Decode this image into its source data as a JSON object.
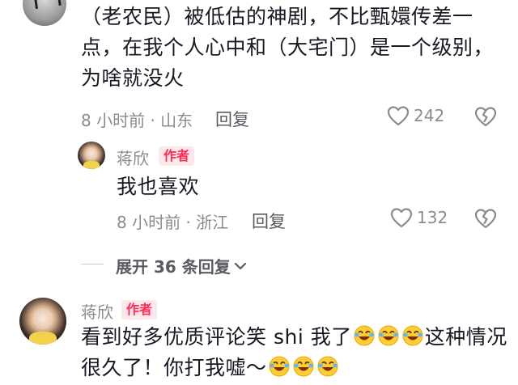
{
  "comments": [
    {
      "text": "（老农民）被低估的神剧，不比甄嬛传差一点，在我个人心中和（大宅门）是一个级别，为啥就没火",
      "line1": "（老农民）被低估的神剧，不比甄嬛传差一",
      "line2": "点，在我个人心中和（大宅门）是一个级别，",
      "line3": "为啥就没火",
      "meta": "8 小时前 · 山东",
      "reply_label": "回复",
      "likes": "242",
      "replies": [
        {
          "username": "蒋欣",
          "badge": "作者",
          "text": "我也喜欢",
          "meta": "8 小时前 · 浙江",
          "reply_label": "回复",
          "likes": "132"
        }
      ],
      "expand_label": "展开 36 条回复"
    },
    {
      "username": "蒋欣",
      "badge": "作者",
      "text_line1": "看到好多优质评论笑 shi 我了",
      "text_line1_after": "这种情况",
      "text_line2": "很久了！你打我嘘～"
    }
  ],
  "icons": {
    "like": "heart-outline-icon",
    "dislike": "broken-heart-icon",
    "expand": "chevron-down-icon",
    "emoji": "rofl-emoji-icon"
  },
  "colors": {
    "badge_bg": "#fce7eb",
    "badge_text": "#fe2c55",
    "meta": "#8a8b91",
    "text": "#161823"
  }
}
